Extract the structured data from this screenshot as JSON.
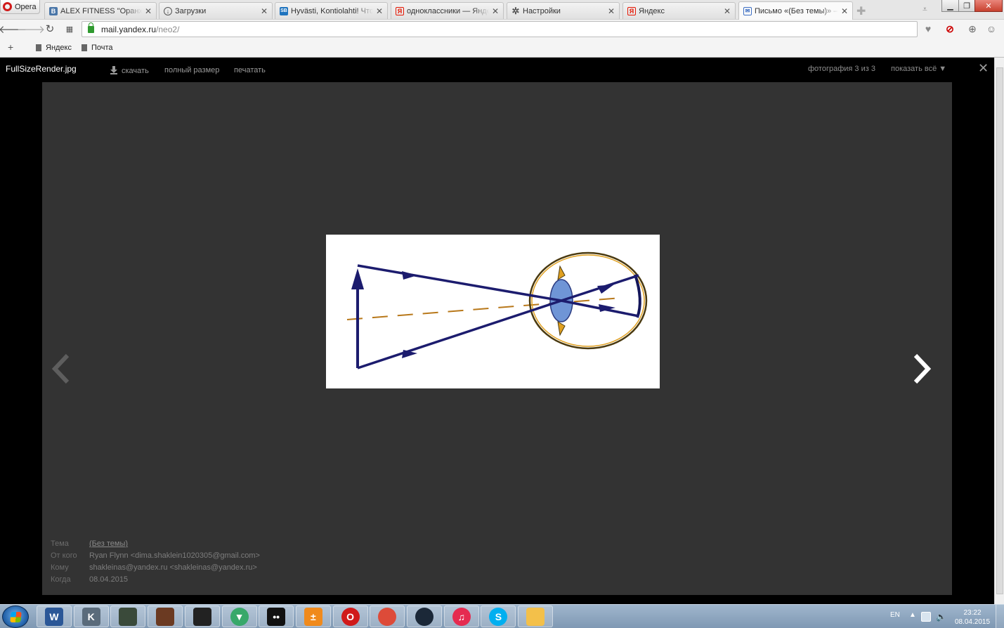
{
  "browser": {
    "menu_label": "Opera",
    "tabs": [
      {
        "label": "ALEX FITNESS \"Оранж Медиа\"",
        "favicon": "vk-icon",
        "color": "#4a76a8",
        "glyph": "В"
      },
      {
        "label": "Загрузки",
        "favicon": "downloads-icon",
        "color": "#777777",
        "glyph": ""
      },
      {
        "label": "Hyvästi, Kontiolahti! Что делать",
        "favicon": "sports-site-icon",
        "color": "#1e73be",
        "glyph": "SB"
      },
      {
        "label": "одноклассники — Яндекс",
        "favicon": "yandex-icon",
        "color": "#e61400",
        "glyph": "Я"
      },
      {
        "label": "Настройки",
        "favicon": "gear-icon",
        "color": "#777777",
        "glyph": ""
      },
      {
        "label": "Яндекс",
        "favicon": "yandex-icon",
        "color": "#e61400",
        "glyph": "Я"
      },
      {
        "label": "Письмо «(Без темы)» — Яндекс",
        "favicon": "mail-icon",
        "color": "#3d6fc4",
        "glyph": ""
      }
    ],
    "url": {
      "host": "mail.yandex.ru",
      "path": "/neo2/"
    },
    "bookmarks": [
      {
        "label": "Яндекс"
      },
      {
        "label": "Почта"
      }
    ]
  },
  "viewer": {
    "file_name": "FullSizeRender.jpg",
    "download_label": "скачать",
    "full_size_label": "полный размер",
    "print_label": "печатать",
    "counter": "фотография 3 из 3",
    "show_all_label": "показать всё ▼",
    "meta": [
      {
        "key": "Тема",
        "value": "(Без темы)"
      },
      {
        "key": "От кого",
        "value": "Ryan Flynn <dima.shaklein1020305@gmail.com>"
      },
      {
        "key": "Кому",
        "value": "shakleinas@yandex.ru <shakleinas@yandex.ru>"
      },
      {
        "key": "Когда",
        "value": "08.04.2015"
      }
    ]
  },
  "taskbar": {
    "apps": [
      {
        "name": "word",
        "color": "#2b5797",
        "glyph": "W"
      },
      {
        "name": "counter-strike",
        "color": "#5a6b7b",
        "glyph": "K"
      },
      {
        "name": "game-1",
        "color": "#3a4a3a",
        "glyph": ""
      },
      {
        "name": "game-2",
        "color": "#6b3a22",
        "glyph": ""
      },
      {
        "name": "game-3",
        "color": "#222222",
        "glyph": ""
      },
      {
        "name": "downloader",
        "color": "#38a86a",
        "glyph": "▼"
      },
      {
        "name": "messenger",
        "color": "#111111",
        "glyph": "••"
      },
      {
        "name": "calculator",
        "color": "#f08a1c",
        "glyph": "±"
      },
      {
        "name": "opera",
        "color": "#d01a1a",
        "glyph": "O"
      },
      {
        "name": "chrome",
        "color": "#dd4b39",
        "glyph": ""
      },
      {
        "name": "steam",
        "color": "#1b2838",
        "glyph": ""
      },
      {
        "name": "itunes",
        "color": "#e52b50",
        "glyph": "♫"
      },
      {
        "name": "skype",
        "color": "#00aff0",
        "glyph": "S"
      },
      {
        "name": "explorer",
        "color": "#f3c04a",
        "glyph": ""
      }
    ],
    "lang": "EN",
    "time": "23:22",
    "date": "08.04.2015"
  }
}
